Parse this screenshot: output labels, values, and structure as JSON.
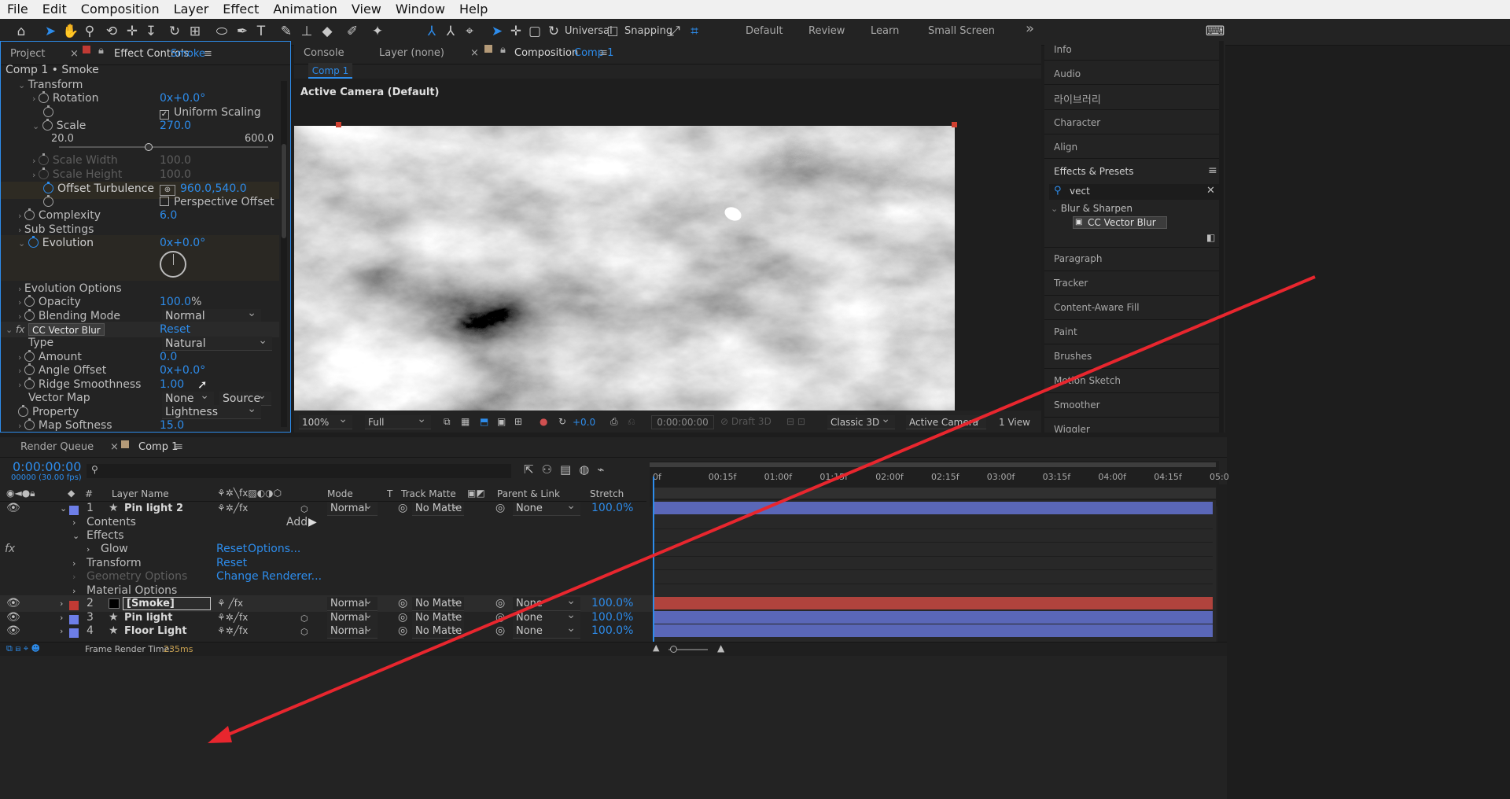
{
  "menu": [
    "File",
    "Edit",
    "Composition",
    "Layer",
    "Effect",
    "Animation",
    "View",
    "Window",
    "Help"
  ],
  "toolbar": {
    "universal": "Universal",
    "snapping": "Snapping",
    "workspaces": [
      "Default",
      "Review",
      "Learn",
      "Small Screen"
    ],
    "more": "»"
  },
  "left_panel": {
    "tab_project": "Project",
    "tab_effect_prefix": "Effect Controls",
    "tab_effect_layer": "Smoke",
    "breadcrumb": "Comp 1 • Smoke"
  },
  "effect": {
    "transform": "Transform",
    "rotation": {
      "label": "Rotation",
      "value": "0x+0.0°"
    },
    "uniform_scaling": "Uniform Scaling",
    "scale": {
      "label": "Scale",
      "value": "270.0",
      "min": "20.0",
      "max": "600.0",
      "slider": 0.43
    },
    "scale_width": {
      "label": "Scale Width",
      "value": "100.0"
    },
    "scale_height": {
      "label": "Scale Height",
      "value": "100.0"
    },
    "offset": {
      "label": "Offset Turbulence",
      "value": "960.0,540.0"
    },
    "perspective": "Perspective Offset",
    "complexity": {
      "label": "Complexity",
      "value": "6.0"
    },
    "sub_settings": "Sub Settings",
    "evolution": {
      "label": "Evolution",
      "value": "0x+0.0°"
    },
    "evolution_options": "Evolution Options",
    "opacity": {
      "label": "Opacity",
      "value": "100.0",
      "unit": "%"
    },
    "blending": {
      "label": "Blending Mode",
      "value": "Normal"
    },
    "cc_name": "CC Vector Blur",
    "cc_reset": "Reset",
    "type": {
      "label": "Type",
      "value": "Natural"
    },
    "amount": {
      "label": "Amount",
      "value": "0.0"
    },
    "angle": {
      "label": "Angle Offset",
      "value": "0x+0.0°"
    },
    "ridge": {
      "label": "Ridge Smoothness",
      "value": "1.00"
    },
    "vector_map": {
      "label": "Vector Map",
      "layer": "None",
      "source": "Source"
    },
    "property": {
      "label": "Property",
      "value": "Lightness"
    },
    "map_softness": {
      "label": "Map Softness",
      "value": "15.0"
    }
  },
  "viewer": {
    "tab_console": "Console",
    "tab_layer": "Layer (none)",
    "tab_comp_prefix": "Composition",
    "tab_comp_name": "Comp 1",
    "sub_tab": "Comp 1",
    "camera_label": "Active Camera (Default)",
    "zoom": "100%",
    "resolution": "Full",
    "exposure": "+0.0",
    "timecode": "0:00:00:00",
    "draft3d": "Draft 3D",
    "renderer": "Classic 3D",
    "camera": "Active Camera ...",
    "views": "1 View"
  },
  "right_panel": {
    "items_top": [
      "Info",
      "Audio",
      "라이브러리",
      "Character",
      "Align"
    ],
    "effects_title": "Effects & Presets",
    "search": "vect",
    "category": "Blur & Sharpen",
    "result": "CC Vector Blur",
    "items_bottom": [
      "Paragraph",
      "Tracker",
      "Content-Aware Fill",
      "Paint",
      "Brushes",
      "Motion Sketch",
      "Smoother",
      "Wiggler"
    ]
  },
  "timeline": {
    "tab_render": "Render Queue",
    "tab_comp": "Comp 1",
    "timecode": "0:00:00:00",
    "frames": "00000 (30.00 fps)",
    "cols": {
      "num": "#",
      "name": "Layer Name",
      "mode": "Mode",
      "t": "T",
      "matte": "Track Matte",
      "parent": "Parent & Link",
      "stretch": "Stretch"
    },
    "ruler": [
      "0f",
      "00:15f",
      "01:00f",
      "01:15f",
      "02:00f",
      "02:15f",
      "03:00f",
      "03:15f",
      "04:00f",
      "04:15f",
      "05:0"
    ],
    "layers": [
      {
        "num": "1",
        "name": "Pin light 2",
        "mode": "Normal",
        "matte": "No Matte",
        "parent": "None",
        "stretch": "100.0%",
        "color": "#6d7ee8"
      },
      {
        "num": "2",
        "name": "[Smoke]",
        "mode": "Normal",
        "matte": "No Matte",
        "parent": "None",
        "stretch": "100.0%",
        "color": "#c13a34"
      },
      {
        "num": "3",
        "name": "Pin light",
        "mode": "Normal",
        "matte": "No Matte",
        "parent": "None",
        "stretch": "100.0%",
        "color": "#6d7ee8"
      },
      {
        "num": "4",
        "name": "Floor Light",
        "mode": "Normal",
        "matte": "No Matte",
        "parent": "None",
        "stretch": "100.0%",
        "color": "#6d7ee8"
      }
    ],
    "sub": {
      "contents": "Contents",
      "add": "Add:",
      "effects": "Effects",
      "glow": "Glow",
      "reset": "Reset",
      "options": "Options...",
      "transform": "Transform",
      "geometry": "Geometry Options",
      "change_renderer": "Change Renderer...",
      "material": "Material Options"
    },
    "status": "Frame Render Time:",
    "status_value": "235ms"
  },
  "colors": {
    "accent": "#2d8ceb",
    "drag_arrow": "#e8262e",
    "layer_blue": "#5a67b8",
    "layer_red": "#b0433d"
  }
}
